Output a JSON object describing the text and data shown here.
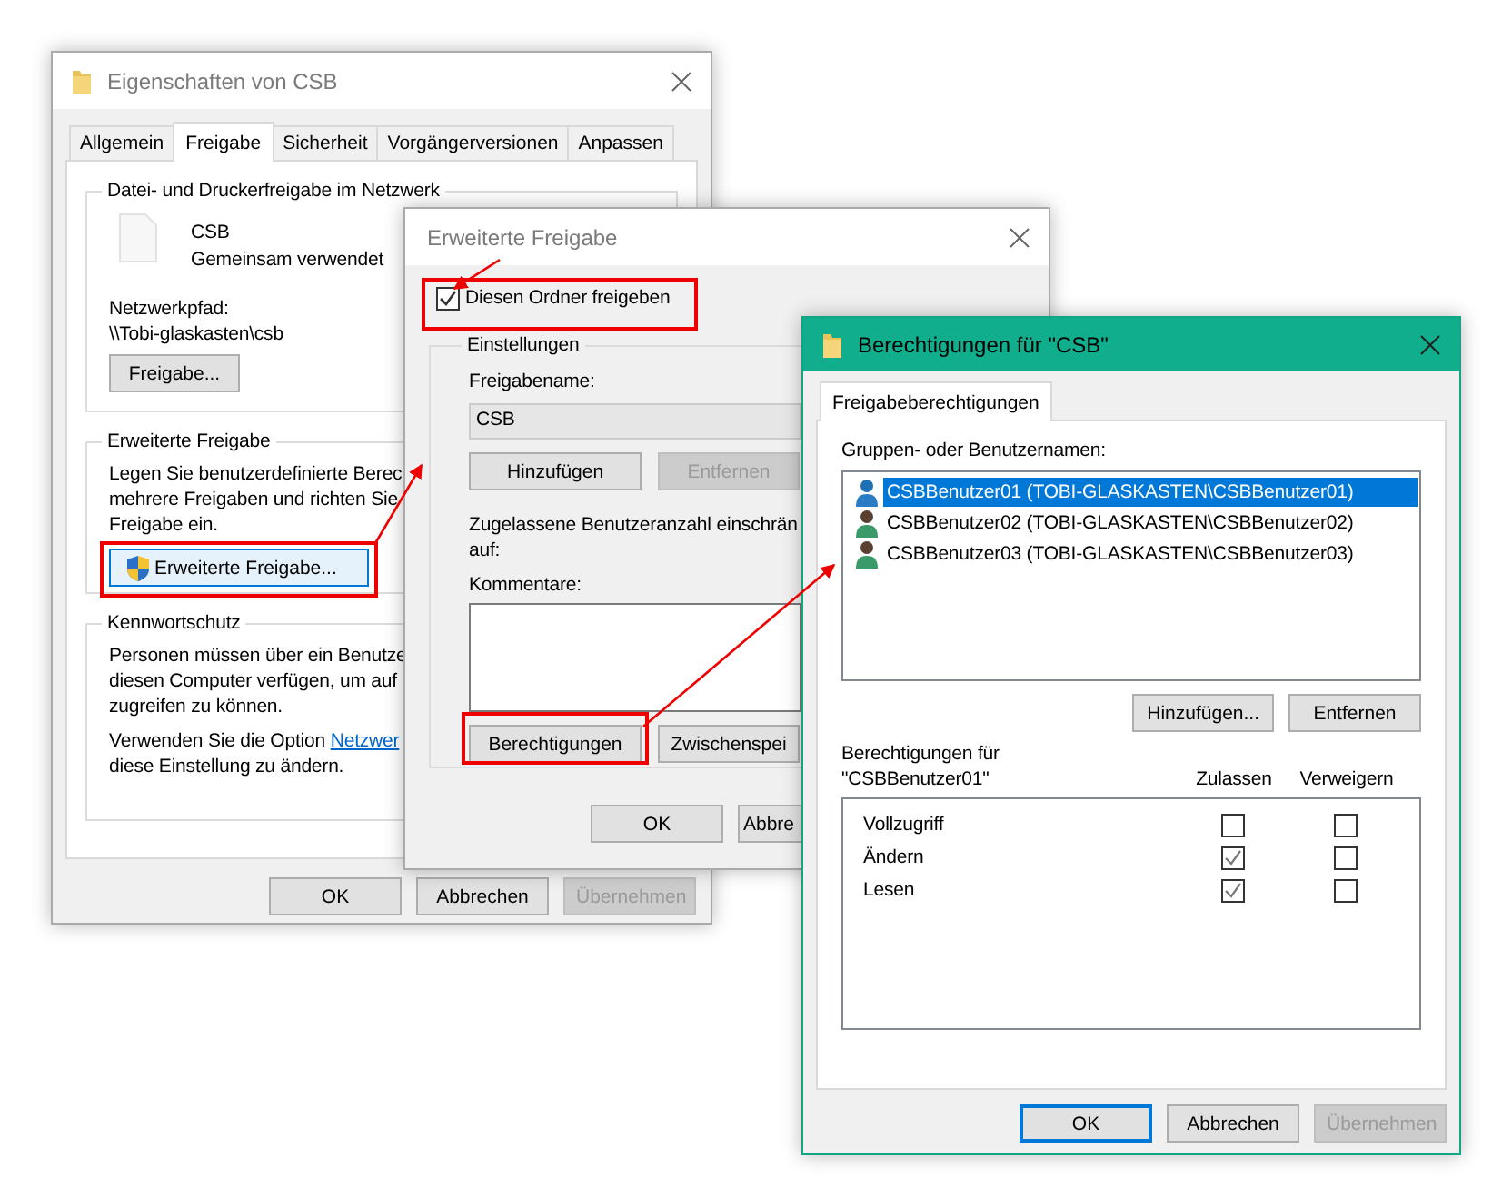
{
  "properties_window": {
    "title": "Eigenschaften von CSB",
    "tabs": [
      {
        "label": "Allgemein",
        "selected": false
      },
      {
        "label": "Freigabe",
        "selected": true
      },
      {
        "label": "Sicherheit",
        "selected": false
      },
      {
        "label": "Vorgängerversionen",
        "selected": false
      },
      {
        "label": "Anpassen",
        "selected": false
      }
    ],
    "network_sharing": {
      "heading": "Datei- und Druckerfreigabe im Netzwerk",
      "name": "CSB",
      "status": "Gemeinsam verwendet",
      "path_label": "Netzwerkpfad:",
      "path": "\\\\Tobi-glaskasten\\csb",
      "button": "Freigabe..."
    },
    "advanced_sharing": {
      "heading": "Erweiterte Freigabe",
      "lines": [
        "Legen Sie benutzerdefinierte Berec",
        "mehrere Freigaben und richten Sie",
        "Freigabe ein."
      ],
      "button": {
        "label": "Erweiterte Freigabe...",
        "focused": true
      }
    },
    "password_protection": {
      "heading": "Kennwortschutz",
      "lines": [
        "Personen müssen über ein Benutze",
        "diesen Computer verfügen, um auf",
        "zugreifen zu können."
      ],
      "option_text": "Verwenden Sie die Option ",
      "option_link": "Netzwer",
      "last_line": "diese Einstellung zu ändern."
    },
    "buttons": [
      {
        "label": "OK",
        "disabled": false
      },
      {
        "label": "Abbrechen",
        "disabled": false
      },
      {
        "label": "Übernehmen",
        "disabled": true
      }
    ]
  },
  "advanced_sharing_window": {
    "title": "Erweiterte Freigabe",
    "share_checkbox": {
      "label": "Diesen Ordner freigeben",
      "checked": true
    },
    "settings": {
      "heading": "Einstellungen",
      "name_label": "Freigabename:",
      "name_value": "CSB",
      "name_buttons": [
        {
          "label": "Hinzufügen",
          "disabled": false
        },
        {
          "label": "Entfernen",
          "disabled": true
        }
      ],
      "limit_lines": [
        "Zugelassene Benutzeranzahl einschrän",
        "auf:"
      ],
      "comments_label": "Kommentare:",
      "action_buttons": [
        {
          "label": "Berechtigungen",
          "disabled": false
        },
        {
          "label": "Zwischenspei",
          "disabled": false
        }
      ]
    },
    "buttons": [
      {
        "label": "OK",
        "disabled": false
      },
      {
        "label": "Abbre",
        "disabled": false
      }
    ]
  },
  "permissions_window": {
    "title": "Berechtigungen für \"CSB\"",
    "tabs": [
      {
        "label": "Freigabeberechtigungen",
        "selected": true
      }
    ],
    "users_label": "Gruppen- oder Benutzernamen:",
    "users": [
      {
        "name": "CSBBenutzer01 (TOBI-GLASKASTEN\\CSBBenutzer01)",
        "selected": true
      },
      {
        "name": "CSBBenutzer02 (TOBI-GLASKASTEN\\CSBBenutzer02)",
        "selected": false
      },
      {
        "name": "CSBBenutzer03 (TOBI-GLASKASTEN\\CSBBenutzer03)",
        "selected": false
      }
    ],
    "user_buttons": [
      {
        "label": "Hinzufügen...",
        "disabled": false
      },
      {
        "label": "Entfernen",
        "disabled": false
      }
    ],
    "permissions_label": [
      "Berechtigungen für",
      "\"CSBBenutzer01\""
    ],
    "columns": [
      "Zulassen",
      "Verweigern"
    ],
    "permissions": [
      {
        "name": "Vollzugriff",
        "allow": false,
        "deny": false
      },
      {
        "name": "Ändern",
        "allow": true,
        "deny": false
      },
      {
        "name": "Lesen",
        "allow": true,
        "deny": false
      }
    ],
    "buttons": [
      {
        "label": "OK",
        "disabled": false,
        "default": true
      },
      {
        "label": "Abbrechen",
        "disabled": false,
        "default": false
      },
      {
        "label": "Übernehmen",
        "disabled": true,
        "default": false
      }
    ]
  }
}
